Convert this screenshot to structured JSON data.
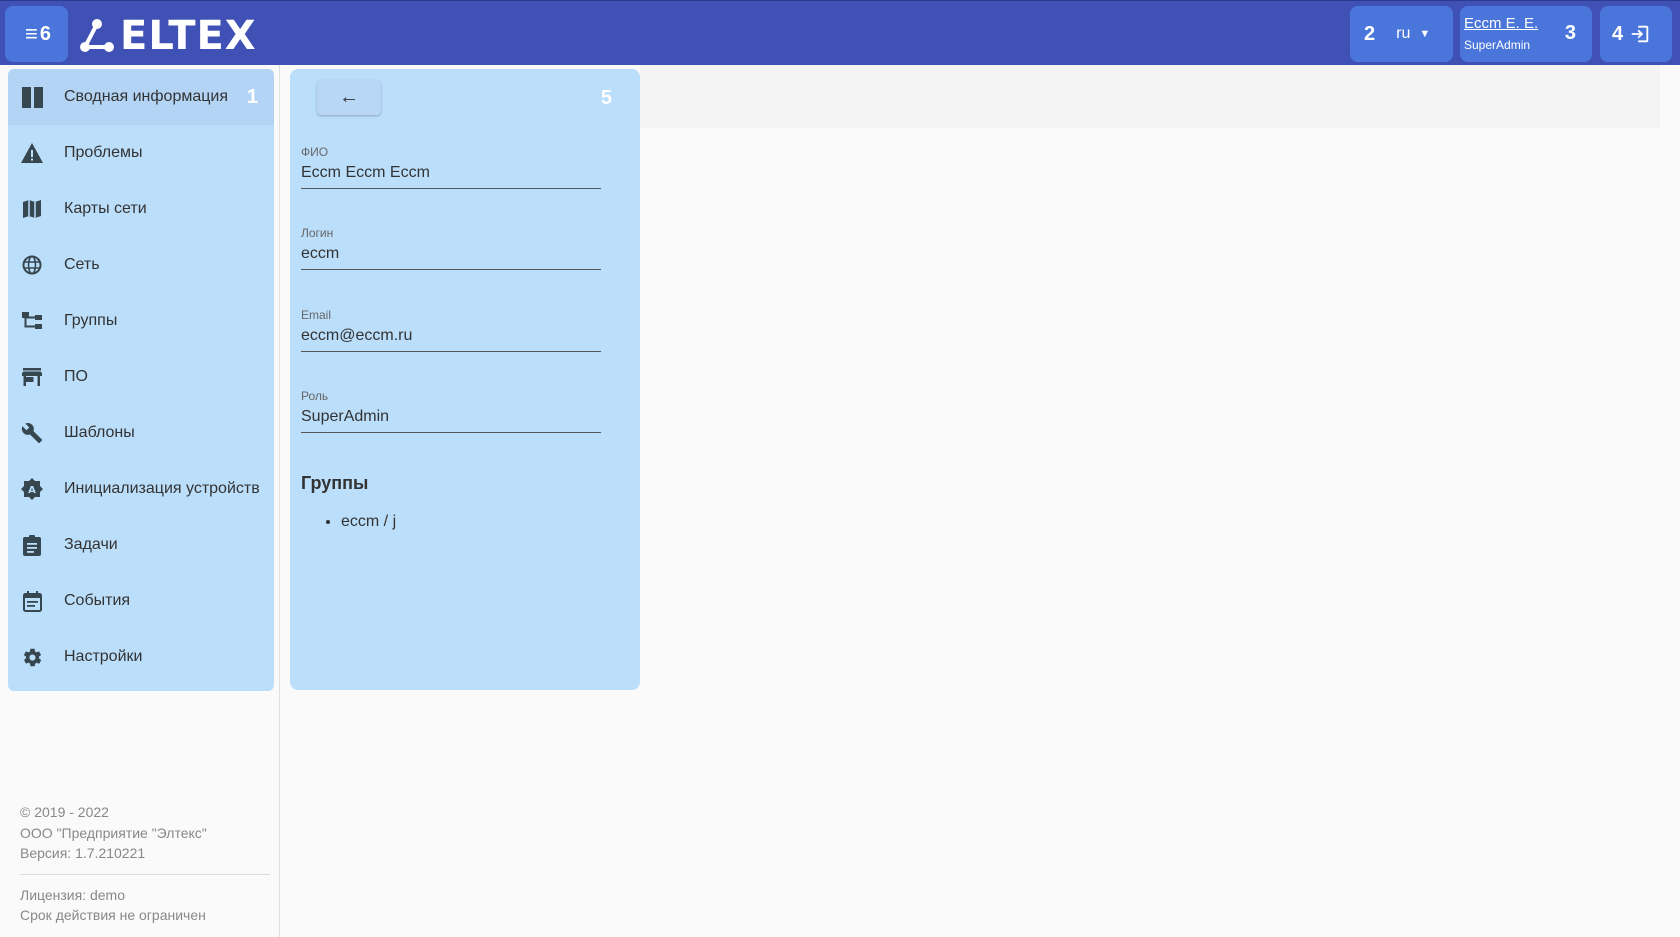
{
  "header": {
    "menu_marker": "6",
    "logo_text": "ELTEX",
    "lang_marker": "2",
    "lang_value": "ru",
    "user_name": "Eccm E. E.",
    "user_role": "SuperAdmin",
    "user_marker": "3",
    "logout_marker": "4"
  },
  "sidebar": {
    "active_marker": "1",
    "items": [
      {
        "label": "Сводная информация",
        "icon": "dashboard-icon"
      },
      {
        "label": "Проблемы",
        "icon": "warning-icon"
      },
      {
        "label": "Карты сети",
        "icon": "map-icon"
      },
      {
        "label": "Сеть",
        "icon": "globe-icon"
      },
      {
        "label": "Группы",
        "icon": "hierarchy-icon"
      },
      {
        "label": "ПО",
        "icon": "store-icon"
      },
      {
        "label": "Шаблоны",
        "icon": "wrench-icon"
      },
      {
        "label": "Инициализация устройств",
        "icon": "badge-a-icon"
      },
      {
        "label": "Задачи",
        "icon": "clipboard-icon"
      },
      {
        "label": "События",
        "icon": "calendar-icon"
      },
      {
        "label": "Настройки",
        "icon": "gear-icon"
      }
    ],
    "footer": {
      "copyright": "© 2019 - 2022",
      "company": "ООО \"Предприятие \"Элтекс\"",
      "version": "Версия: 1.7.210221",
      "license": "Лицензия: demo",
      "validity": "Срок действия не ограничен"
    }
  },
  "detail": {
    "marker": "5",
    "fields": [
      {
        "label": "ФИО",
        "value": "Eccm Eccm Eccm"
      },
      {
        "label": "Логин",
        "value": "eccm"
      },
      {
        "label": "Email",
        "value": "eccm@eccm.ru"
      },
      {
        "label": "Роль",
        "value": "SuperAdmin"
      }
    ],
    "groups_title": "Группы",
    "groups": [
      "eccm / j"
    ]
  }
}
